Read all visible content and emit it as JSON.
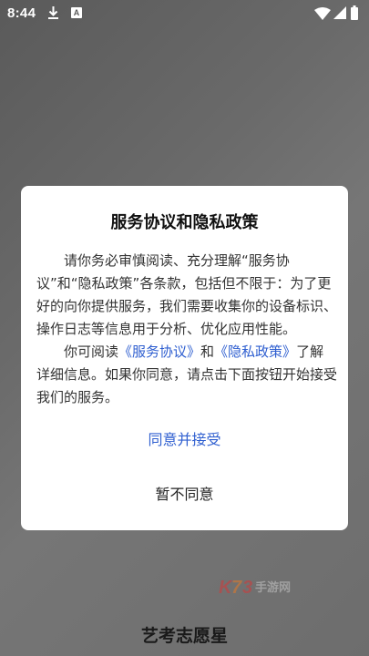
{
  "status_bar": {
    "time": "8:44",
    "icons": [
      "download-icon",
      "a-icon",
      "wifi-icon",
      "signal-icon",
      "battery-icon"
    ],
    "a_icon_glyph": "A"
  },
  "dialog": {
    "title": "服务协议和隐私政策",
    "paragraph1": "请你务必审慎阅读、充分理解“服务协议”和“隐私政策”各条款，包括但不限于：为了更好的向你提供服务，我们需要收集你的设备标识、操作日志等信息用于分析、优化应用性能。",
    "paragraph2_prefix": "你可阅读",
    "service_link": "《服务协议》",
    "paragraph2_and": "和",
    "privacy_link": "《隐私政策》",
    "paragraph2_suffix": "了解详细信息。如果你同意，请点击下面按钮开始接受我们的服务。",
    "accept_label": "同意并接受",
    "decline_label": "暂不同意"
  },
  "watermark": {
    "icon": "k73-watermark-logo",
    "text": "K73手游网"
  },
  "app": {
    "name": "艺考志愿星"
  },
  "colors": {
    "link": "#2f5fd0",
    "overlay_bg": "#6a6a6a",
    "dialog_bg": "#ffffff"
  }
}
